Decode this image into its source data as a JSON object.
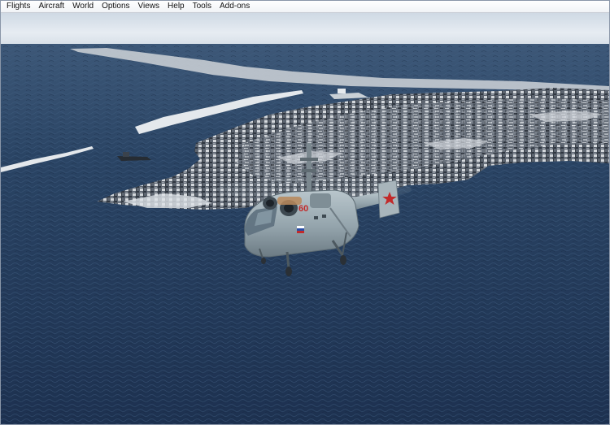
{
  "menu": {
    "flights": "Flights",
    "aircraft": "Aircraft",
    "world": "World",
    "options": "Options",
    "views": "Views",
    "help": "Help",
    "tools": "Tools",
    "addons": "Add-ons"
  },
  "aircraft": {
    "tail_number": "60"
  },
  "colors": {
    "sea": "#22385a",
    "sky": "#dde6ef",
    "helicopter": "#9aa9b0",
    "tail_star": "#c22a2a"
  }
}
